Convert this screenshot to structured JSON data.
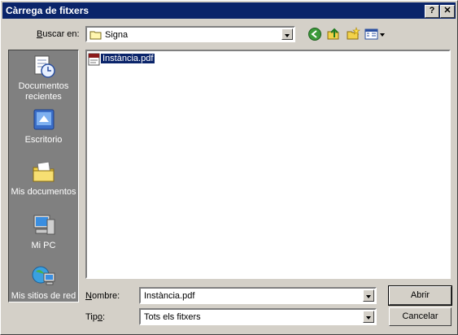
{
  "window": {
    "title": "Càrrega de fitxers",
    "help_btn": "?",
    "close_btn": "✕"
  },
  "lookin": {
    "label": "Buscar en:",
    "value": "Signa"
  },
  "places": [
    {
      "label": "Documentos recientes",
      "icon": "recent-documents-icon"
    },
    {
      "label": "Escritorio",
      "icon": "desktop-icon"
    },
    {
      "label": "Mis documentos",
      "icon": "my-documents-icon"
    },
    {
      "label": "Mi PC",
      "icon": "my-computer-icon"
    },
    {
      "label": "Mis sitios de red",
      "icon": "network-places-icon"
    }
  ],
  "files": [
    {
      "name": "Instància.pdf",
      "icon": "pdf-file-icon",
      "selected": true
    }
  ],
  "filename": {
    "label": "Nombre:",
    "value": "Instància.pdf"
  },
  "filetype": {
    "label": "Tipo:",
    "value": "Tots els fitxers"
  },
  "buttons": {
    "open": "Abrir",
    "cancel": "Cancelar"
  },
  "colors": {
    "titlebar": "#0a246a",
    "dialog_bg": "#d4d0c8",
    "places_bg": "#808080",
    "selection": "#0a246a"
  }
}
